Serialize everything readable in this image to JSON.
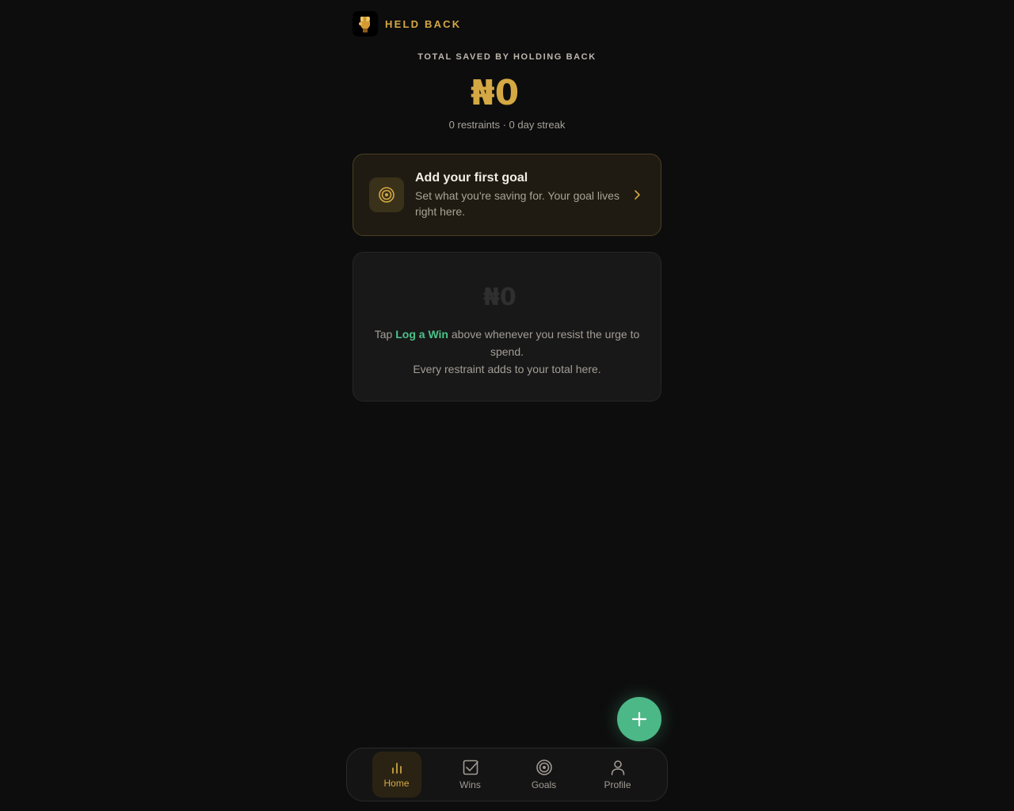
{
  "header": {
    "brand": "HELD BACK"
  },
  "hero": {
    "label": "TOTAL SAVED BY HOLDING BACK",
    "amount": "₦0",
    "meta": "0 restraints · 0 day streak"
  },
  "goal_card": {
    "title": "Add your first goal",
    "subtitle": "Set what you're saving for. Your goal lives right here."
  },
  "empty_state": {
    "amount": "₦0",
    "text_before": "Tap ",
    "highlight": "Log a Win",
    "text_after": " above whenever you resist the urge to spend.",
    "line2": "Every restraint adds to your total here."
  },
  "nav": {
    "items": [
      {
        "label": "Home",
        "icon": "bar-chart-icon",
        "active": true
      },
      {
        "label": "Wins",
        "icon": "checkbox-icon",
        "active": false
      },
      {
        "label": "Goals",
        "icon": "target-icon",
        "active": false
      },
      {
        "label": "Profile",
        "icon": "person-icon",
        "active": false
      }
    ]
  },
  "colors": {
    "accent": "#d4a843",
    "success": "#4cb887",
    "background": "#0d0d0d"
  }
}
